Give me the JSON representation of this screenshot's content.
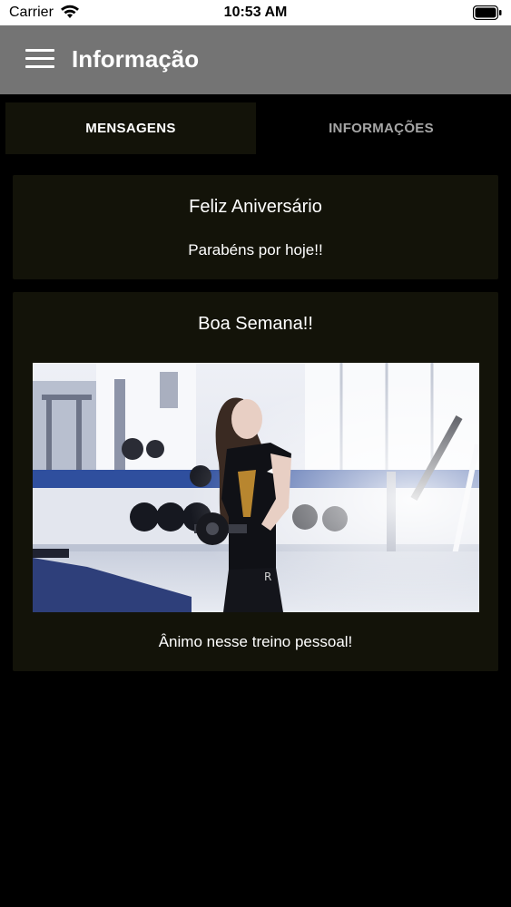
{
  "status_bar": {
    "carrier": "Carrier",
    "time": "10:53 AM"
  },
  "app_bar": {
    "title": "Informação"
  },
  "tabs": [
    {
      "label": "MENSAGENS",
      "active": true
    },
    {
      "label": "INFORMAÇÕES",
      "active": false
    }
  ],
  "messages": [
    {
      "title": "Feliz Aniversário",
      "body": "Parabéns por hoje!!"
    },
    {
      "title": "Boa Semana!!",
      "body": "Ânimo nesse treino pessoal!",
      "image": "gym-photo"
    }
  ],
  "colors": {
    "background": "#000000",
    "app_bar": "#747474",
    "card": "#131309",
    "tab_inactive_text": "#a6a6a6"
  }
}
